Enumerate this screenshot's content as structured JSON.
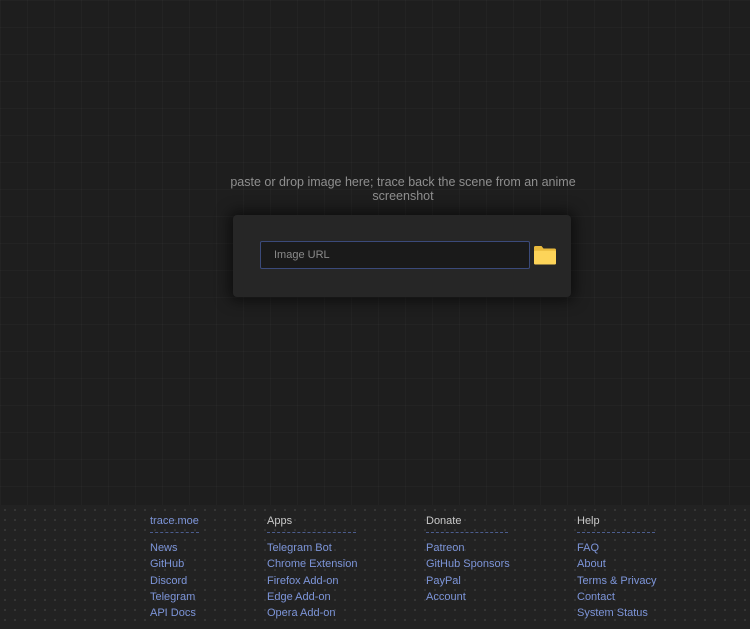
{
  "main": {
    "tagline": "paste or drop image here; trace back the scene from an anime screenshot",
    "url_placeholder": "Image URL",
    "url_value": "",
    "folder_icon": "folder-icon",
    "folder_color": "#fdd459"
  },
  "footer": {
    "columns": [
      {
        "title": "trace.moe",
        "links": [
          "News",
          "GitHub",
          "Discord",
          "Telegram",
          "API Docs"
        ]
      },
      {
        "title": "Apps",
        "links": [
          "Telegram Bot",
          "Chrome Extension",
          "Firefox Add-on",
          "Edge Add-on",
          "Opera Add-on"
        ]
      },
      {
        "title": "Donate",
        "links": [
          "Patreon",
          "GitHub Sponsors",
          "PayPal",
          "Account"
        ]
      },
      {
        "title": "Help",
        "links": [
          "FAQ",
          "About",
          "Terms & Privacy",
          "Contact",
          "System Status"
        ]
      }
    ]
  },
  "colors": {
    "background": "#1e1e1e",
    "link": "#7d95d9",
    "input_border": "#3b4a7a"
  }
}
